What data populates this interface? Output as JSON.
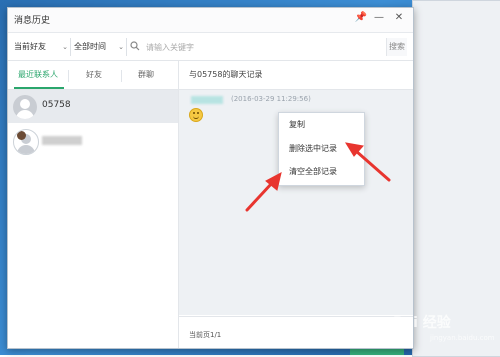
{
  "window": {
    "title": "消息历史"
  },
  "toolbar": {
    "friend_filter": "当前好友",
    "time_filter": "全部时间",
    "search_placeholder": "请输入关键字",
    "search_button": "搜索"
  },
  "left_tabs": [
    {
      "label": "最近联系人",
      "active": true
    },
    {
      "label": "好友",
      "active": false
    },
    {
      "label": "群聊",
      "active": false
    }
  ],
  "contacts": [
    {
      "name": "05758",
      "selected": true
    },
    {
      "name": "",
      "selected": false
    }
  ],
  "chat": {
    "header": "与05758的聊天记录",
    "messages": [
      {
        "time": "(2016-03-29 11:29:56)",
        "content": "smiley-emoji"
      }
    ],
    "footer": "当前页1/1"
  },
  "context_menu": {
    "items": [
      "复制",
      "删除选中记录",
      "清空全部记录"
    ]
  },
  "watermark": {
    "text": "Bai 经验",
    "sub": "jingyan.baidu.com"
  },
  "colors": {
    "accent_green": "#2aa66c",
    "arrow_red": "#e8352f"
  }
}
